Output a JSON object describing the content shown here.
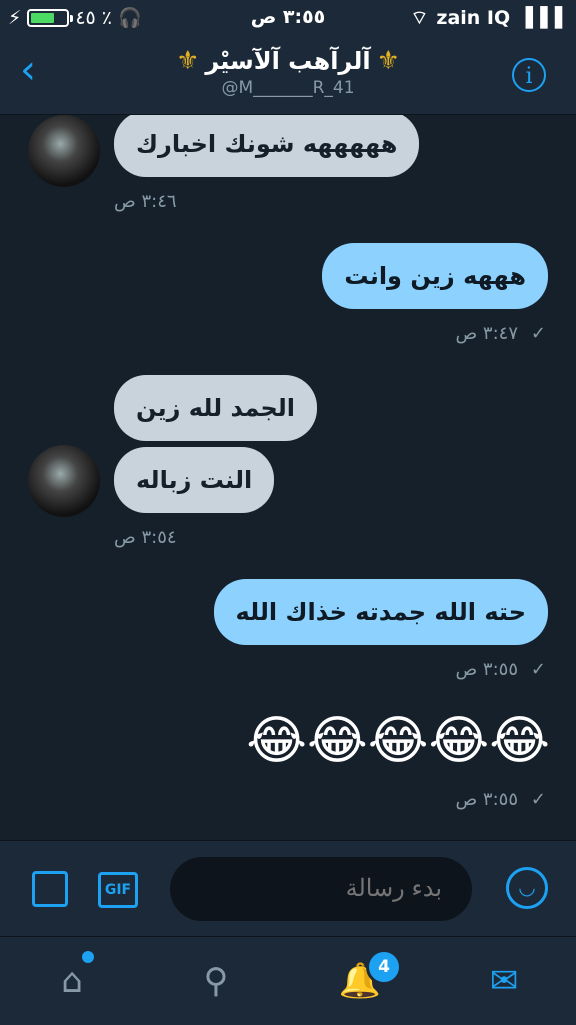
{
  "status": {
    "battery": "٤٥ ٪",
    "time": "٣:٥٥ ص",
    "carrier": "zain IQ"
  },
  "header": {
    "title": "آلرآهب آلآسيْر",
    "handle": "@M_______R_41",
    "fleur": "⚜"
  },
  "messages": [
    {
      "dir": "in",
      "text": "هههههه شونك اخبارك",
      "time": "٣:٤٦ ص"
    },
    {
      "dir": "out",
      "text": "هههه زين وانت",
      "time": "٣:٤٧ ص"
    },
    {
      "dir": "in",
      "text": "الجمد لله زين"
    },
    {
      "dir": "in",
      "text": "النت زباله",
      "time": "٣:٥٤ ص"
    },
    {
      "dir": "out",
      "text": "حته الله جمدته خذاك الله",
      "time": "٣:٥٥ ص"
    },
    {
      "dir": "out",
      "text": "😂😂😂😂😂",
      "time": "٣:٥٥ ص"
    }
  ],
  "composer": {
    "placeholder": "بدء رسالة",
    "gif": "GIF"
  },
  "tabs": {
    "notifications_count": "4"
  },
  "icons": [
    "back-chevron-icon",
    "info-icon",
    "image-icon",
    "gif-icon",
    "emoji-icon",
    "home-icon",
    "search-icon",
    "bell-icon",
    "mail-icon"
  ]
}
